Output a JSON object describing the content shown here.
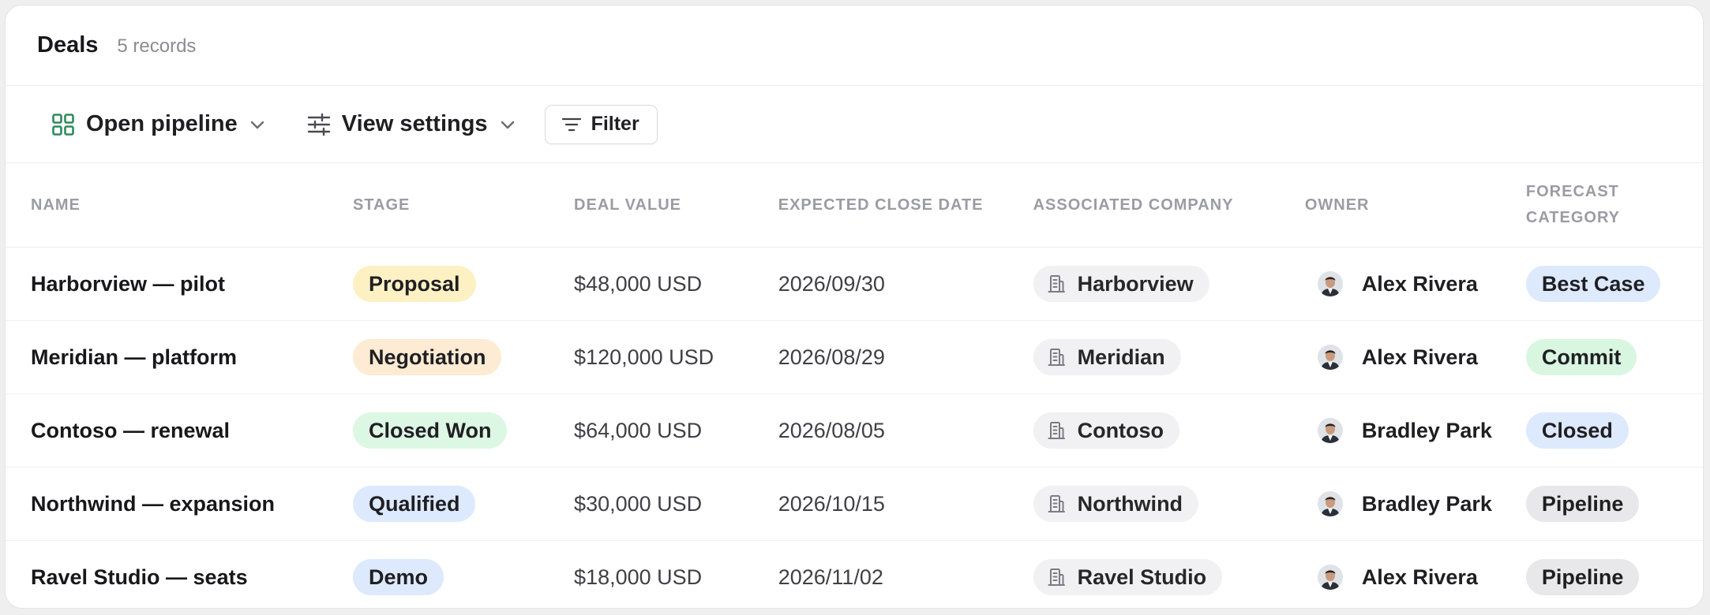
{
  "header": {
    "title": "Deals",
    "record_count": "5 records"
  },
  "toolbar": {
    "view_label": "Open pipeline",
    "view_icon": "grid-icon",
    "settings_label": "View settings",
    "settings_icon": "sliders-icon",
    "filter_label": "Filter",
    "filter_icon": "filter-icon"
  },
  "table": {
    "columns": [
      "NAME",
      "STAGE",
      "DEAL VALUE",
      "EXPECTED CLOSE DATE",
      "ASSOCIATED COMPANY",
      "OWNER",
      "FORECAST CATEGORY"
    ],
    "rows": [
      {
        "name": "Harborview — pilot",
        "stage": "Proposal",
        "value": "$48,000 USD",
        "close": "2026/09/30",
        "company": "Harborview",
        "owner": "Alex Rivera",
        "forecast": "Best Case"
      },
      {
        "name": "Meridian — platform",
        "stage": "Negotiation",
        "value": "$120,000 USD",
        "close": "2026/08/29",
        "company": "Meridian",
        "owner": "Alex Rivera",
        "forecast": "Commit"
      },
      {
        "name": "Contoso — renewal",
        "stage": "Closed Won",
        "value": "$64,000 USD",
        "close": "2026/08/05",
        "company": "Contoso",
        "owner": "Bradley Park",
        "forecast": "Closed"
      },
      {
        "name": "Northwind — expansion",
        "stage": "Qualified",
        "value": "$30,000 USD",
        "close": "2026/10/15",
        "company": "Northwind",
        "owner": "Bradley Park",
        "forecast": "Pipeline"
      },
      {
        "name": "Ravel Studio — seats",
        "stage": "Demo",
        "value": "$18,000 USD",
        "close": "2026/11/02",
        "company": "Ravel Studio",
        "owner": "Alex Rivera",
        "forecast": "Pipeline"
      }
    ]
  },
  "colors": {
    "stage_proposal": "#fdf1c4",
    "stage_negotiation": "#fdebd3",
    "stage_closed_won": "#dcf7e3",
    "stage_qualified": "#dde9fd",
    "stage_demo": "#dde9fd",
    "forecast_best_case": "#dde9fd",
    "forecast_commit": "#d9f6e1",
    "forecast_closed": "#dde9fd",
    "forecast_pipeline": "#e8e8eb",
    "accent_grid_icon": "#2f8a5b"
  }
}
